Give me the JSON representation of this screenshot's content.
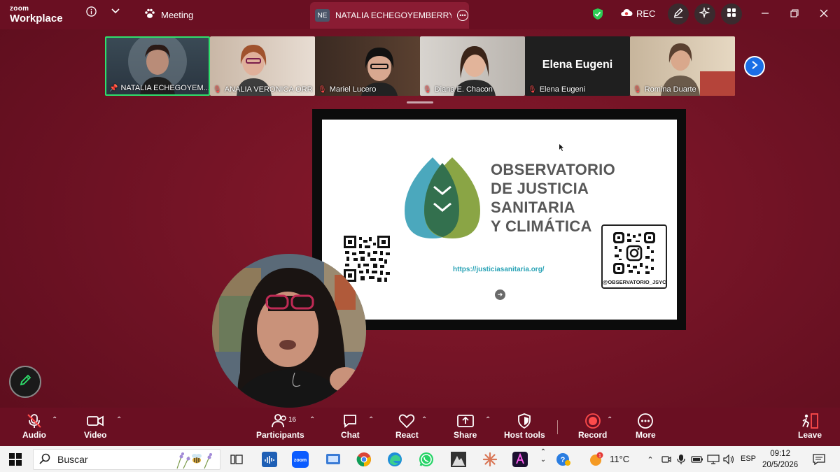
{
  "app": {
    "brand_small": "zoom",
    "brand_main": "Workplace"
  },
  "titlebar": {
    "meeting_label": "Meeting",
    "share_badge": "NE",
    "share_tab_label": "NATALIA ECHEGOYEMBERRY's sci",
    "rec_label": "REC"
  },
  "gallery": [
    {
      "name": "NATALIA ECHEGOYEM...",
      "icon": "pin-icon",
      "active": true
    },
    {
      "name": "ANALIA VERONICA ORR",
      "icon": "mic-muted-icon"
    },
    {
      "name": "Mariel Lucero",
      "icon": "mic-muted-icon"
    },
    {
      "name": "Diana E. Chacon",
      "icon": "mic-muted-icon"
    },
    {
      "name": "Elena Eugeni",
      "icon": "mic-muted-icon",
      "display_text": "Elena Eugeni"
    },
    {
      "name": "Romina Duarte",
      "icon": "mic-muted-icon"
    }
  ],
  "slide": {
    "title_lines": [
      "OBSERVATORIO",
      "DE JUSTICIA",
      "SANITARIA",
      "Y CLIMÁTICA"
    ],
    "url": "https://justiciasanitaria.org/",
    "handle": "@OBSERVATORIO_JSYC"
  },
  "toolbar": {
    "audio": "Audio",
    "video": "Video",
    "participants": "Participants",
    "participants_count": "16",
    "chat": "Chat",
    "react": "React",
    "share": "Share",
    "host_tools": "Host tools",
    "record": "Record",
    "more": "More",
    "leave": "Leave"
  },
  "taskbar": {
    "search_placeholder": "Buscar",
    "temperature": "11°C",
    "language": "ESP",
    "time": "09:12",
    "date": "20/5/2026",
    "weather_badge": "1"
  },
  "colors": {
    "accent": "#6a0f22",
    "active_border": "#2ee06c",
    "teal": "#4ba8bd",
    "olive": "#8aa545"
  }
}
